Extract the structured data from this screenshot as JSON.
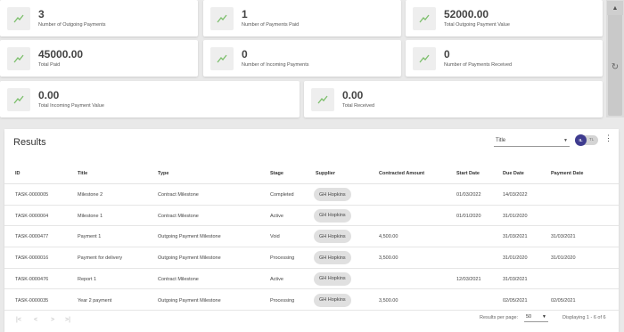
{
  "stats": [
    {
      "value": "3",
      "label": "Number of Outgoing Payments",
      "icon": "trend-up-icon"
    },
    {
      "value": "1",
      "label": "Number of Payments Paid",
      "icon": "trend-up-icon"
    },
    {
      "value": "52000.00",
      "label": "Total Outgoing Payment Value",
      "icon": "trend-up-icon"
    },
    {
      "value": "45000.00",
      "label": "Total Paid",
      "icon": "trend-up-icon"
    },
    {
      "value": "0",
      "label": "Number of Incoming Payments",
      "icon": "trend-up-icon"
    },
    {
      "value": "0",
      "label": "Number of Payments Received",
      "icon": "trend-up-icon"
    },
    {
      "value": "0.00",
      "label": "Total Incoming Payment Value",
      "icon": "trend-up-icon"
    },
    {
      "value": "0.00",
      "label": "Total Received",
      "icon": "trend-up-icon"
    }
  ],
  "results": {
    "title": "Results",
    "sort_select": "Title",
    "toggle_on": "IL",
    "toggle_off": "TL",
    "columns": [
      "ID",
      "Title",
      "Type",
      "Stage",
      "Supplier",
      "Contracted Amount",
      "Start Date",
      "Due Date",
      "Payment Date"
    ],
    "rows": [
      [
        "TASK-0000005",
        "Milestone 2",
        "Contract Milestone",
        "Completed",
        "GH Hopkins",
        "",
        "01/03/2022",
        "14/03/2022",
        ""
      ],
      [
        "TASK-0000004",
        "Milestone 1",
        "Contract Milestone",
        "Active",
        "GH Hopkins",
        "",
        "01/01/2020",
        "31/01/2020",
        ""
      ],
      [
        "TASK-0000477",
        "Payment 1",
        "Outgoing Payment Milestone",
        "Void",
        "GH Hopkins",
        "4,500.00",
        "",
        "31/03/2021",
        "31/03/2021"
      ],
      [
        "TASK-0000016",
        "Payment for delivery",
        "Outgoing Payment Milestone",
        "Processing",
        "GH Hopkins",
        "3,500.00",
        "",
        "31/01/2020",
        "31/01/2020"
      ],
      [
        "TASK-0000476",
        "Report 1",
        "Contract Milestone",
        "Active",
        "GH Hopkins",
        "",
        "12/03/2021",
        "31/03/2021",
        ""
      ],
      [
        "TASK-0000035",
        "Year 2 payment",
        "Outgoing Payment Milestone",
        "Processing",
        "GH Hopkins",
        "3,500.00",
        "",
        "02/05/2021",
        "02/05/2021"
      ]
    ],
    "per_page_label": "Results per page:",
    "per_page_value": "50",
    "displaying": "Displaying 1 - 6 of 6",
    "pager": [
      "|<",
      "<",
      ">",
      ">|"
    ]
  },
  "colors": {
    "accent": "#3f3c8f",
    "trend": "#7cbf6b"
  }
}
